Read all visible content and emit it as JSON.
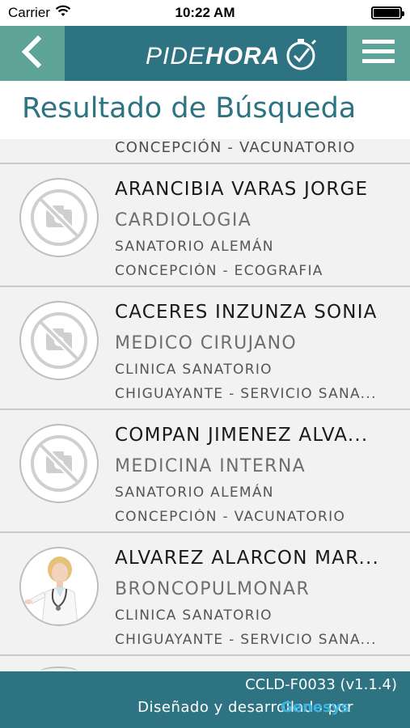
{
  "status_bar": {
    "carrier": "Carrier",
    "time": "10:22 AM",
    "icons": [
      "wifi-icon",
      "battery-icon"
    ]
  },
  "nav": {
    "back_icon": "chevron-left-icon",
    "menu_icon": "hamburger-menu-icon",
    "logo_part1": "PIDE",
    "logo_part2": "HORA",
    "logo_icon": "clock-check-icon"
  },
  "page": {
    "title": "Resultado de Búsqueda"
  },
  "results": {
    "partial_top_line": "CONCEPCIÓN - VACUNATORIO",
    "items": [
      {
        "name": "ARANCIBIA VARAS JORGE",
        "specialty": "CARDIOLOGIA",
        "place_line1": "SANATORIO ALEMÁN",
        "place_line2": "CONCEPCIÓN - ECOGRAFIA",
        "photo": "no-photo-icon"
      },
      {
        "name": "CACERES INZUNZA SONIA",
        "specialty": "MEDICO CIRUJANO",
        "place_line1": "CLINICA SANATORIO",
        "place_line2": "CHIGUAYANTE - SERVICIO SANA...",
        "photo": "no-photo-icon"
      },
      {
        "name": "COMPAN JIMENEZ ALVA...",
        "specialty": "MEDICINA INTERNA",
        "place_line1": "SANATORIO ALEMÁN",
        "place_line2": "CONCEPCIÓN - VACUNATORIO",
        "photo": "no-photo-icon"
      },
      {
        "name": "ALVAREZ ALARCON MAR...",
        "specialty": "BRONCOPULMONAR",
        "place_line1": "CLINICA SANATORIO",
        "place_line2": "CHIGUAYANTE - SERVICIO SANA...",
        "photo": "doctor-photo"
      }
    ]
  },
  "footer": {
    "code": "CCLD-F0033 (v1.1.4)",
    "credit_prefix": "Diseñado y desarrollado por",
    "brand": "Genesys"
  },
  "colors": {
    "primary": "#2e7381",
    "accent": "#5ea397",
    "brand_link": "#3bb3e0"
  }
}
